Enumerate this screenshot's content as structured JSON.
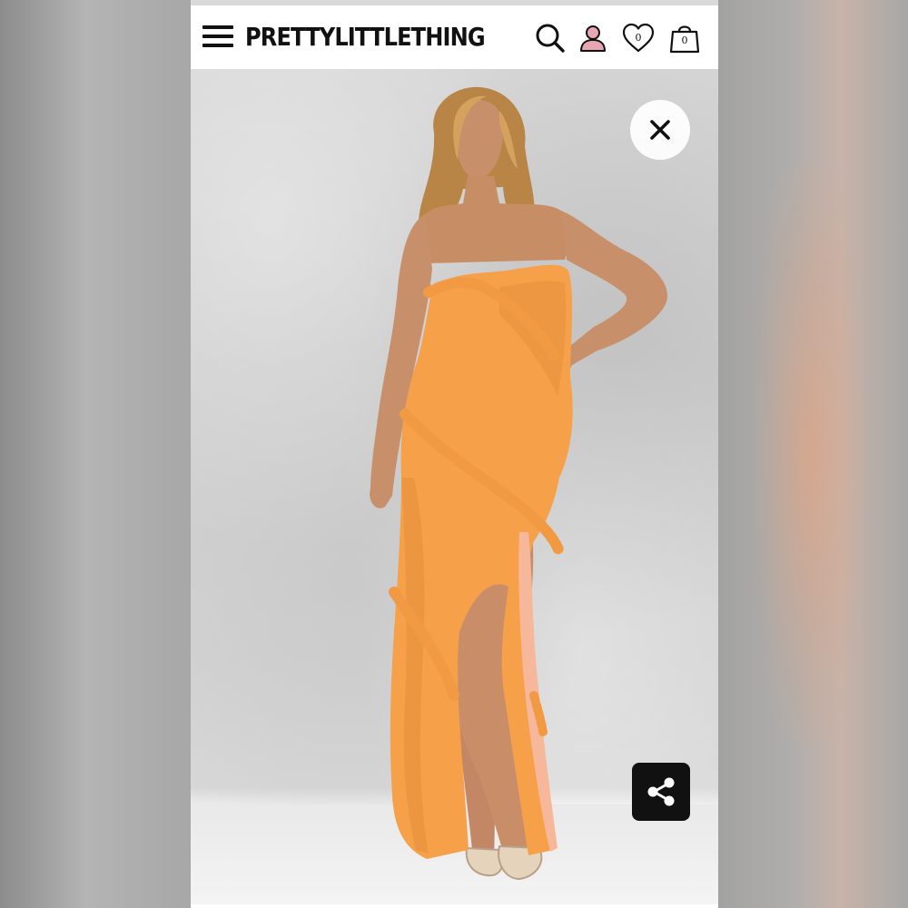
{
  "header": {
    "brand": "PRETTYLITTLETHING",
    "icons": [
      "menu-icon",
      "search-icon",
      "account-icon",
      "wishlist-heart-icon",
      "shopping-bag-icon"
    ],
    "wishlist_count": "0",
    "bag_count": "0",
    "account_icon_color": "#e7a6b2"
  },
  "product_image": {
    "garment_color": "#f6a04a",
    "controls": {
      "close_icon": "close-icon",
      "share_icon": "share-icon"
    }
  }
}
